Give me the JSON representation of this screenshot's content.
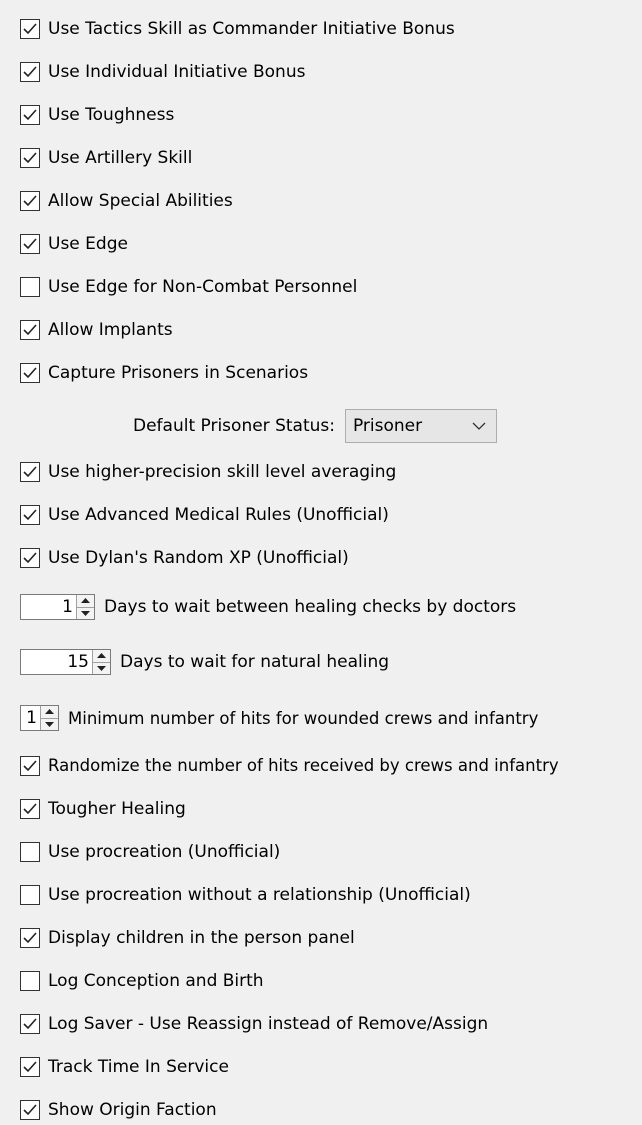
{
  "checkboxes_top": [
    {
      "label": "Use Tactics Skill as Commander Initiative Bonus",
      "checked": true
    },
    {
      "label": "Use Individual Initiative Bonus",
      "checked": true
    },
    {
      "label": "Use Toughness",
      "checked": true
    },
    {
      "label": "Use Artillery Skill",
      "checked": true
    },
    {
      "label": "Allow Special Abilities",
      "checked": true
    },
    {
      "label": "Use Edge",
      "checked": true
    },
    {
      "label": "Use Edge for Non-Combat Personnel",
      "checked": false
    },
    {
      "label": "Allow Implants",
      "checked": true
    },
    {
      "label": "Capture Prisoners in Scenarios",
      "checked": true
    }
  ],
  "prisoner_status": {
    "label": "Default Prisoner Status:",
    "value": "Prisoner"
  },
  "checkboxes_mid": [
    {
      "label": "Use higher-precision skill level averaging",
      "checked": true
    },
    {
      "label": "Use Advanced Medical Rules (Unofficial)",
      "checked": true
    },
    {
      "label": "Use Dylan's Random XP (Unofficial)",
      "checked": true
    }
  ],
  "spinners": [
    {
      "value": "1",
      "label": "Days to wait between healing checks by doctors"
    },
    {
      "value": "15",
      "label": "Days to wait for natural healing"
    },
    {
      "value": "1",
      "label": "Minimum number of hits for wounded crews and infantry"
    }
  ],
  "checkboxes_bottom": [
    {
      "label": "Randomize the number of hits received by crews and infantry",
      "checked": true
    },
    {
      "label": "Tougher Healing",
      "checked": true
    },
    {
      "label": "Use procreation (Unofficial)",
      "checked": false
    },
    {
      "label": "Use procreation without a relationship (Unofficial)",
      "checked": false
    },
    {
      "label": "Display children in the person panel",
      "checked": true
    },
    {
      "label": "Log Conception and Birth",
      "checked": false
    },
    {
      "label": "Log Saver - Use Reassign instead of Remove/Assign",
      "checked": true
    },
    {
      "label": "Track Time In Service",
      "checked": true
    },
    {
      "label": "Show Origin Faction",
      "checked": true
    }
  ]
}
